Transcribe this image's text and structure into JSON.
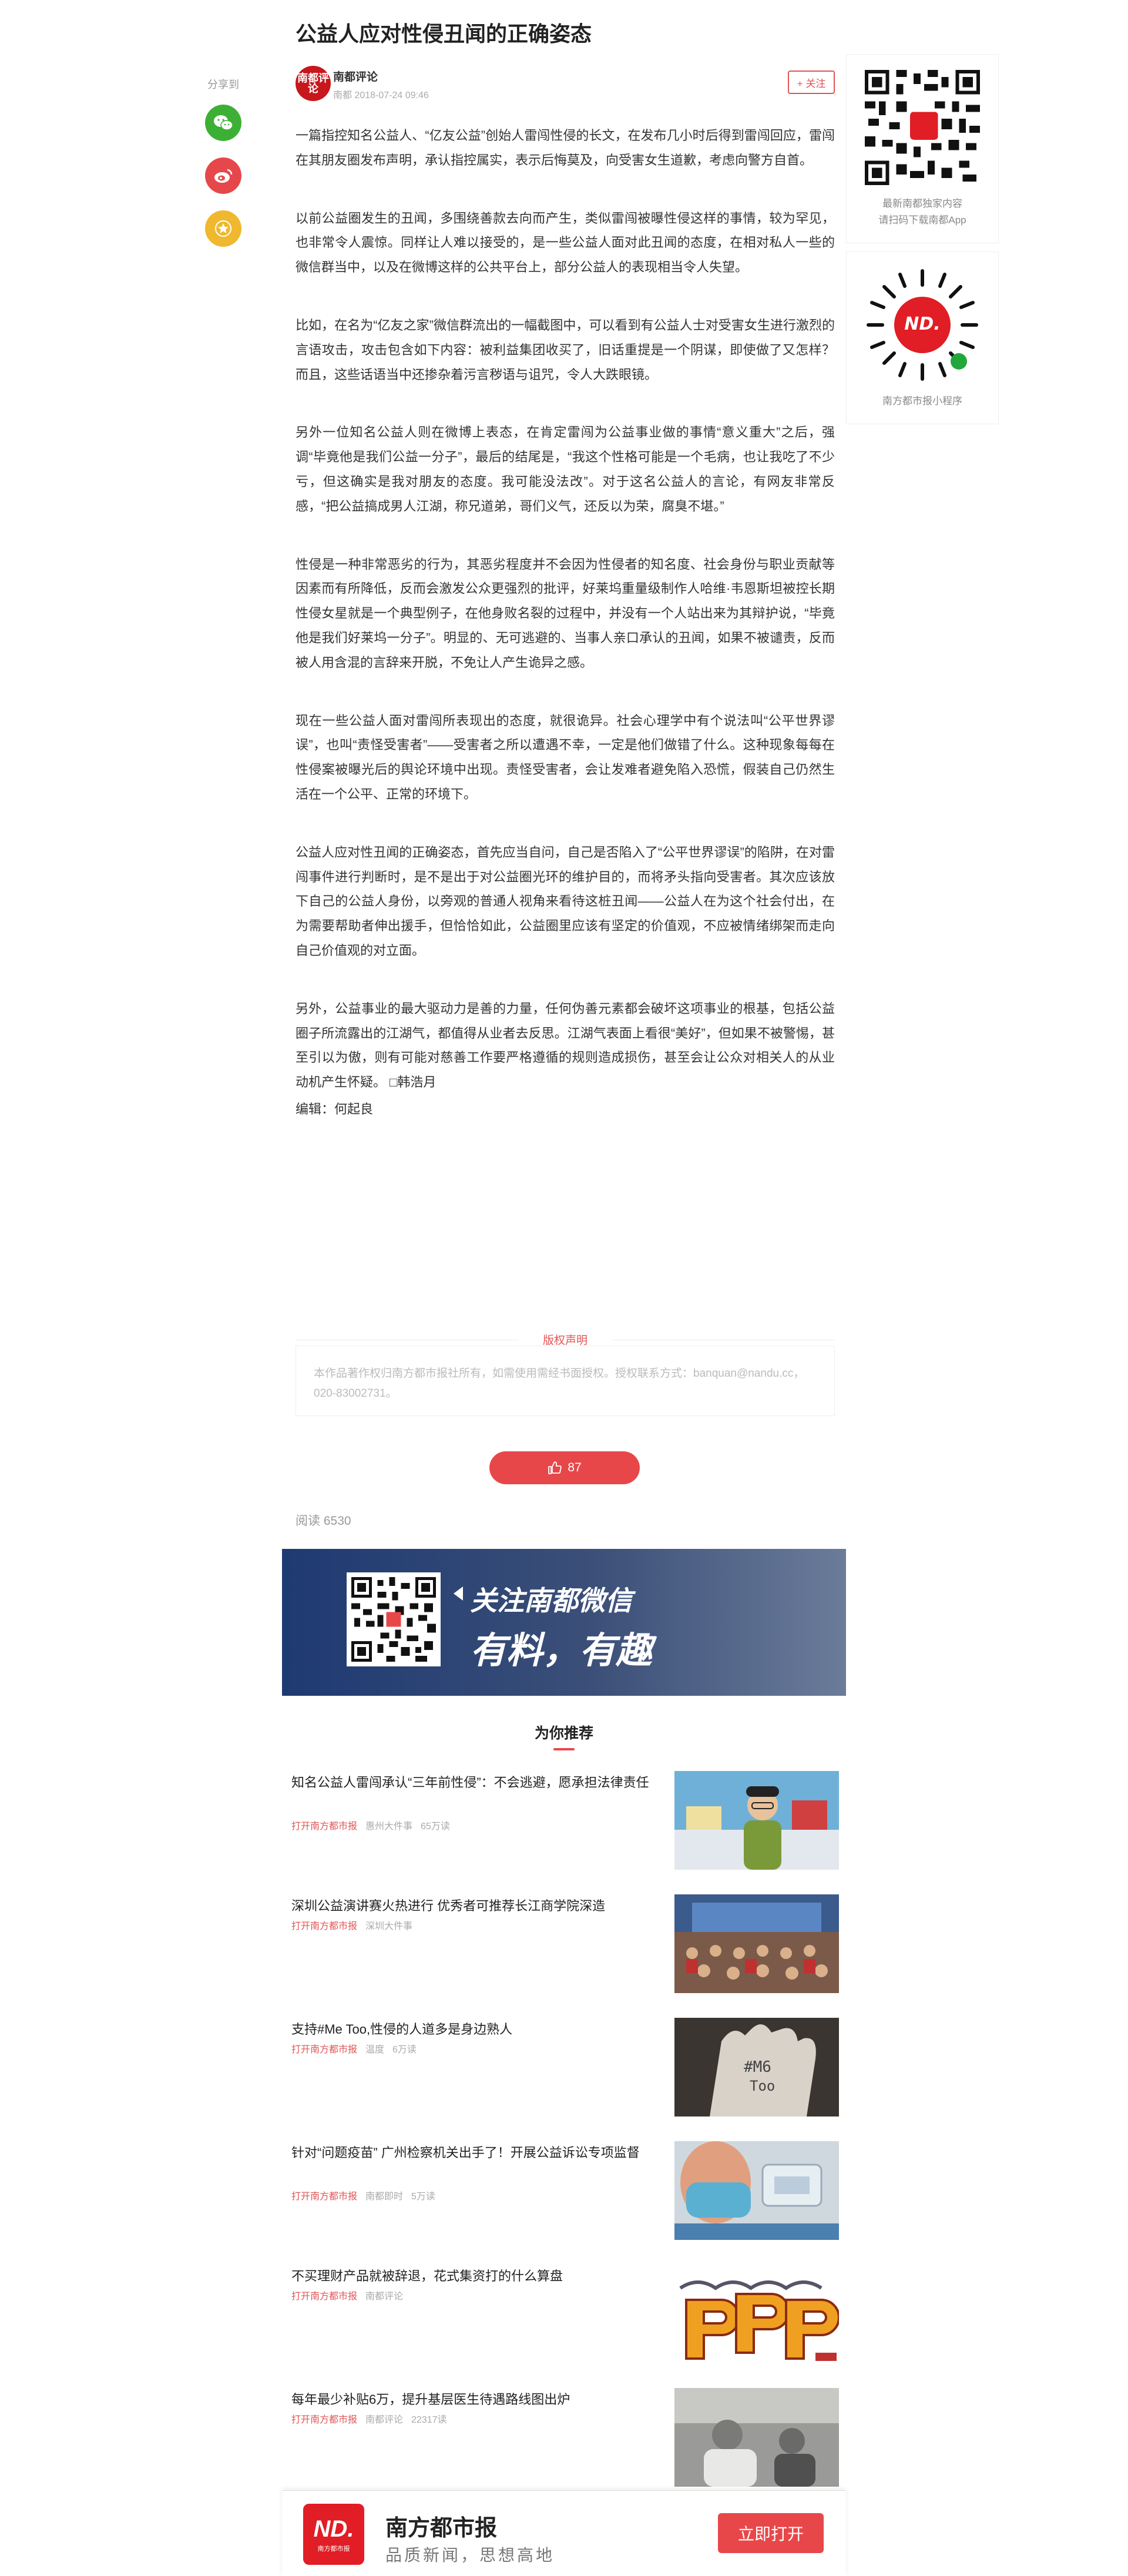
{
  "article": {
    "title": "公益人应对性侵丑闻的正确姿态",
    "author": "南都评论",
    "avatar_text": "南都评论",
    "meta": "南都   2018-07-24 09:46",
    "follow_label": "+ 关注",
    "paragraphs": [
      "一篇指控知名公益人、“亿友公益”创始人雷闯性侵的长文，在发布几小时后得到雷闯回应，雷闯在其朋友圈发布声明，承认指控属实，表示后悔莫及，向受害女生道歉，考虑向警方自首。",
      "以前公益圈发生的丑闻，多围绕善款去向而产生，类似雷闯被曝性侵这样的事情，较为罕见，也非常令人震惊。同样让人难以接受的，是一些公益人面对此丑闻的态度，在相对私人一些的微信群当中，以及在微博这样的公共平台上，部分公益人的表现相当令人失望。",
      "比如，在名为“亿友之家”微信群流出的一幅截图中，可以看到有公益人士对受害女生进行激烈的言语攻击，攻击包含如下内容：被利益集团收买了，旧话重提是一个阴谋，即使做了又怎样？而且，这些话语当中还掺杂着污言秽语与诅咒，令人大跌眼镜。",
      "另外一位知名公益人则在微博上表态，在肯定雷闯为公益事业做的事情“意义重大”之后，强调“毕竟他是我们公益一分子”，最后的结尾是，“我这个性格可能是一个毛病，也让我吃了不少亏，但这确实是我对朋友的态度。我可能没法改”。对于这名公益人的言论，有网友非常反感，“把公益搞成男人江湖，称兄道弟，哥们义气，还反以为荣，腐臭不堪。”",
      "性侵是一种非常恶劣的行为，其恶劣程度并不会因为性侵者的知名度、社会身份与职业贡献等因素而有所降低，反而会激发公众更强烈的批评，好莱坞重量级制作人哈维·韦恩斯坦被控长期性侵女星就是一个典型例子，在他身败名裂的过程中，并没有一个人站出来为其辩护说，“毕竟他是我们好莱坞一分子”。明显的、无可逃避的、当事人亲口承认的丑闻，如果不被谴责，反而被人用含混的言辞来开脱，不免让人产生诡异之感。",
      "现在一些公益人面对雷闯所表现出的态度，就很诡异。社会心理学中有个说法叫“公平世界谬误”，也叫“责怪受害者”——受害者之所以遭遇不幸，一定是他们做错了什么。这种现象每每在性侵案被曝光后的舆论环境中出现。责怪受害者，会让发难者避免陷入恐慌，假装自己仍然生活在一个公平、正常的环境下。",
      "公益人应对性丑闻的正确姿态，首先应当自问，自己是否陷入了“公平世界谬误”的陷阱，在对雷闯事件进行判断时，是不是出于对公益圈光环的维护目的，而将矛头指向受害者。其次应该放下自己的公益人身份，以旁观的普通人视角来看待这桩丑闻——公益人在为这个社会付出，在为需要帮助者伸出援手，但恰恰如此，公益圈里应该有坚定的价值观，不应被情绪绑架而走向自己价值观的对立面。",
      "另外，公益事业的最大驱动力是善的力量，任何伪善元素都会破坏这项事业的根基，包括公益圈子所流露出的江湖气，都值得从业者去反思。江湖气表面上看很“美好”，但如果不被警惕，甚至引以为傲，则有可能对慈善工作要严格遵循的规则造成损伤，甚至会让公众对相关人的从业动机产生怀疑。 □韩浩月"
    ],
    "editor": "编辑：何起良",
    "copyright_title": "版权声明",
    "copyright_text": "本作品著作权归南方都市报社所有，如需使用需经书面授权。授权联系方式：banquan@nandu.cc，020-83002731。",
    "like_count": "87",
    "reads": "阅读 6530"
  },
  "share": {
    "label": "分享到"
  },
  "sidebar": {
    "app_caption": "最新南都独家内容\n请扫码下载南都App",
    "mini_caption": "南方都市报小程序"
  },
  "banner": {
    "line1": "关注南都微信",
    "line2": "有料，有趣"
  },
  "recommend": {
    "title": "为你推荐",
    "items": [
      {
        "title": "知名公益人雷闯承认“三年前性侵”：不会逃避，愿承担法律责任",
        "source": "打开南方都市报",
        "tag": "惠州大件事",
        "views": "65万读"
      },
      {
        "title": "深圳公益演讲赛火热进行 优秀者可推荐长江商学院深造",
        "source": "打开南方都市报",
        "tag": "深圳大件事",
        "views": ""
      },
      {
        "title": "支持#Me Too,性侵的人道多是身边熟人",
        "source": "打开南方都市报",
        "tag": "温度",
        "views": "6万读"
      },
      {
        "title": "针对“问题疫苗” 广州检察机关出手了！开展公益诉讼专项监督",
        "source": "打开南方都市报",
        "tag": "南都即时",
        "views": "5万读"
      },
      {
        "title": "不买理财产品就被辞退，花式集资打的什么算盘",
        "source": "打开南方都市报",
        "tag": "南都评论",
        "views": ""
      },
      {
        "title": "每年最少补贴6万，提升基层医生待遇路线图出炉",
        "source": "打开南方都市报",
        "tag": "南都评论",
        "views": "22317读"
      }
    ]
  },
  "app_bar": {
    "logo_text": "ND.",
    "logo_sub": "南方都市报",
    "name": "南方都市报",
    "slogan": "品质新闻，思想高地",
    "open_label": "立即打开"
  },
  "colors": {
    "accent": "#e8474a",
    "wechat": "#3cb034",
    "weibo": "#e6474b",
    "favorite": "#f0b82e",
    "banner": "#1e3a72"
  }
}
